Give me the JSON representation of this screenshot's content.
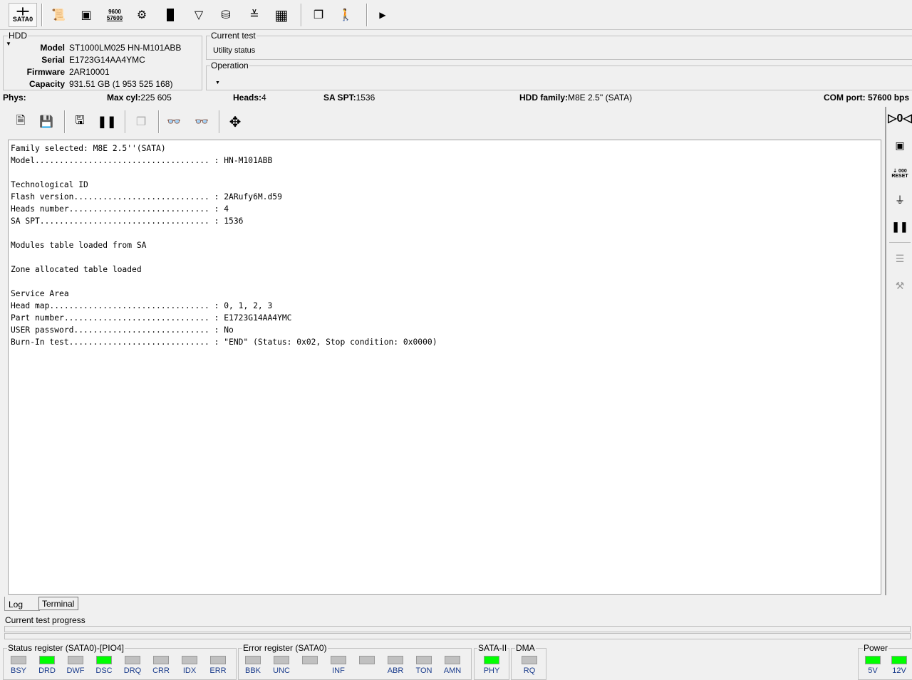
{
  "toolbar": {
    "port_label": "SATA0",
    "icons": [
      "port-icon",
      "info-icon",
      "board-icon",
      "baud-rate-icon",
      "settings-disk-icon",
      "chip-icon",
      "ruler-icon",
      "disk-icon",
      "stack-icon",
      "grid-icon",
      "windows-icon",
      "exit-icon",
      "play-icon"
    ],
    "baud_top": "9600",
    "baud_bottom": "57600"
  },
  "hdd": {
    "title": "HDD",
    "model_label": "Model",
    "model": "ST1000LM025 HN-M101ABB",
    "serial_label": "Serial",
    "serial": "E1723G14AA4YMC",
    "firmware_label": "Firmware",
    "firmware": "2AR10001",
    "capacity_label": "Capacity",
    "capacity": "931.51 GB (1 953 525 168)"
  },
  "current_test": {
    "title": "Current test",
    "value": "Utility status"
  },
  "operation": {
    "title": "Operation"
  },
  "phys": {
    "label": "Phys:",
    "maxcyl_label": "Max cyl:",
    "maxcyl": "225 605",
    "heads_label": "Heads:",
    "heads": "4",
    "saspt_label": "SA SPT:",
    "saspt": "1536",
    "family_label": "HDD family:",
    "family": "M8E 2.5'' (SATA)",
    "com_label": "COM port:",
    "com": "57600 bps"
  },
  "log_lines": [
    "Family selected: M8E 2.5''(SATA)",
    "Model.................................... : HN-M101ABB",
    "",
    "Technological ID",
    "Flash version............................ : 2ARufy6M.d59",
    "Heads number............................. : 4",
    "SA SPT................................... : 1536",
    "",
    "Modules table loaded from SA",
    "",
    "Zone allocated table loaded",
    "",
    "Service Area",
    "Head map................................. : 0, 1, 2, 3",
    "Part number.............................. : E1723G14AA4YMC",
    "USER password............................ : No",
    "Burn-In test............................. : \"END\" (Status: 0x02, Stop condition: 0x0000)"
  ],
  "right_icons": {
    "reset_label": "RESET"
  },
  "tabs": {
    "log": "Log",
    "terminal": "Terminal"
  },
  "progress": {
    "label": "Current test progress",
    "value": 0
  },
  "status_register": {
    "title": "Status register (SATA0)-[PIO4]",
    "leds": [
      {
        "label": "BSY",
        "on": false
      },
      {
        "label": "DRD",
        "on": true
      },
      {
        "label": "DWF",
        "on": false
      },
      {
        "label": "DSC",
        "on": true
      },
      {
        "label": "DRQ",
        "on": false
      },
      {
        "label": "CRR",
        "on": false
      },
      {
        "label": "IDX",
        "on": false
      },
      {
        "label": "ERR",
        "on": false
      }
    ]
  },
  "error_register": {
    "title": "Error register (SATA0)",
    "leds": [
      {
        "label": "BBK",
        "on": false
      },
      {
        "label": "UNC",
        "on": false
      },
      {
        "label": "",
        "on": false
      },
      {
        "label": "INF",
        "on": false
      },
      {
        "label": "",
        "on": false
      },
      {
        "label": "ABR",
        "on": false
      },
      {
        "label": "TON",
        "on": false
      },
      {
        "label": "AMN",
        "on": false
      }
    ]
  },
  "sata": {
    "title": "SATA-II",
    "label": "PHY",
    "on": true
  },
  "dma": {
    "title": "DMA",
    "label": "RQ",
    "on": false
  },
  "power": {
    "title": "Power",
    "v5": "5V",
    "v12": "12V",
    "v5_on": true,
    "v12_on": true
  }
}
